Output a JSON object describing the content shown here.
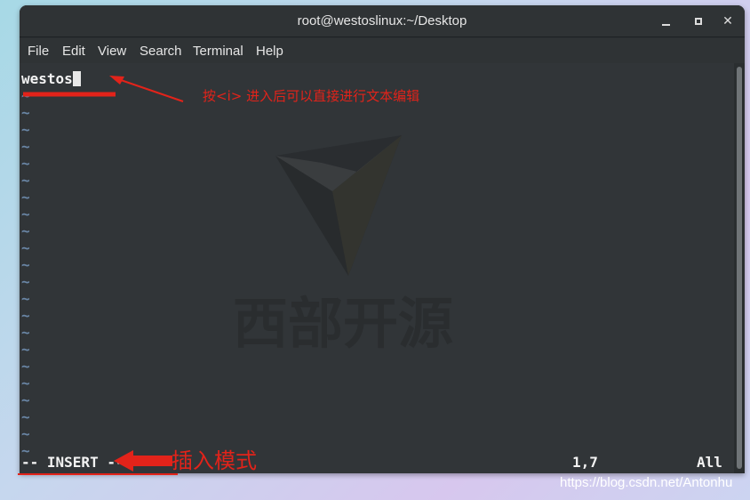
{
  "window": {
    "title": "root@westoslinux:~/Desktop",
    "controls": {
      "minimize": "minimize-icon",
      "maximize": "maximize-icon",
      "close": "✕"
    }
  },
  "menu": [
    "File",
    "Edit",
    "View",
    "Search",
    "Terminal",
    "Help"
  ],
  "editor": {
    "first_line": "westos",
    "tilde": "~",
    "tilde_count": 22,
    "mode": "-- INSERT --",
    "position": "1,7",
    "scroll": "All"
  },
  "watermark": {
    "text": "西部开源"
  },
  "annotations": {
    "press_i": "按<i>   进入后可以直接进行文本编辑",
    "insert_mode": "插入模式"
  },
  "footer": {
    "url": "https://blog.csdn.net/Antonhu"
  },
  "colors": {
    "terminal_bg": "#313538",
    "annotation": "#e2231a",
    "tilde": "#6a86a6"
  }
}
